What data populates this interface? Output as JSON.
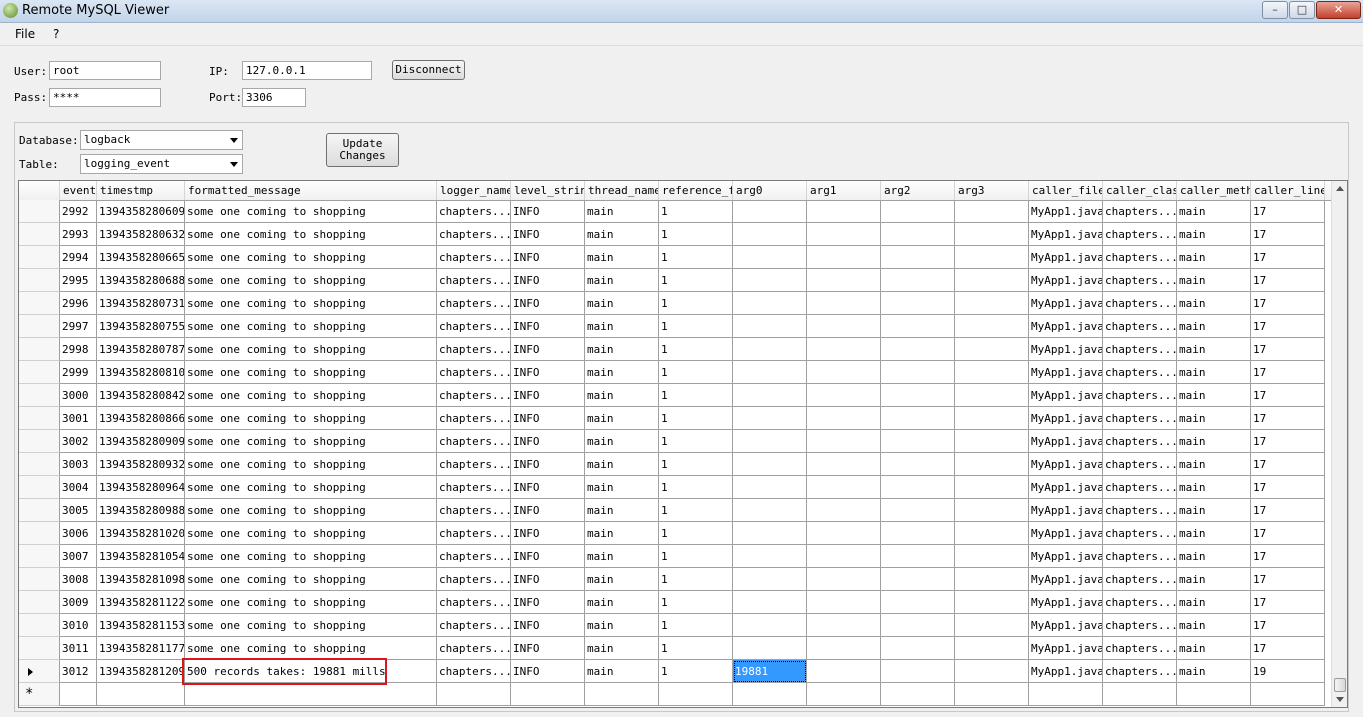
{
  "window": {
    "title": "Remote MySQL Viewer",
    "min": "–",
    "max": "□",
    "close": "✕"
  },
  "menu": [
    {
      "label": "File"
    },
    {
      "label": "?"
    }
  ],
  "connection": {
    "user_label": "User:",
    "user_value": "root",
    "pass_label": "Pass:",
    "pass_value": "****",
    "ip_label": "IP:",
    "ip_value": "127.0.0.1",
    "port_label": "Port:",
    "port_value": "3306",
    "disconnect_label": "Disconnect"
  },
  "selection": {
    "database_label": "Database:",
    "database_value": "logback",
    "table_label": "Table:",
    "table_value": "logging_event",
    "update_line1": "Update",
    "update_line2": "Changes"
  },
  "grid": {
    "columns": [
      "event",
      "timestmp",
      "formatted_message",
      "logger_name",
      "level_strin",
      "thread_name",
      "reference_f",
      "arg0",
      "arg1",
      "arg2",
      "arg3",
      "caller_file",
      "caller_clas",
      "caller_meth",
      "caller_line"
    ],
    "rows": [
      [
        "2992",
        "1394358280609",
        "some one coming to shopping",
        "chapters...",
        "INFO",
        "main",
        "1",
        "",
        "",
        "",
        "",
        "MyApp1.java",
        "chapters...",
        "main",
        "17"
      ],
      [
        "2993",
        "1394358280632",
        "some one coming to shopping",
        "chapters...",
        "INFO",
        "main",
        "1",
        "",
        "",
        "",
        "",
        "MyApp1.java",
        "chapters...",
        "main",
        "17"
      ],
      [
        "2994",
        "1394358280665",
        "some one coming to shopping",
        "chapters...",
        "INFO",
        "main",
        "1",
        "",
        "",
        "",
        "",
        "MyApp1.java",
        "chapters...",
        "main",
        "17"
      ],
      [
        "2995",
        "1394358280688",
        "some one coming to shopping",
        "chapters...",
        "INFO",
        "main",
        "1",
        "",
        "",
        "",
        "",
        "MyApp1.java",
        "chapters...",
        "main",
        "17"
      ],
      [
        "2996",
        "1394358280731",
        "some one coming to shopping",
        "chapters...",
        "INFO",
        "main",
        "1",
        "",
        "",
        "",
        "",
        "MyApp1.java",
        "chapters...",
        "main",
        "17"
      ],
      [
        "2997",
        "1394358280755",
        "some one coming to shopping",
        "chapters...",
        "INFO",
        "main",
        "1",
        "",
        "",
        "",
        "",
        "MyApp1.java",
        "chapters...",
        "main",
        "17"
      ],
      [
        "2998",
        "1394358280787",
        "some one coming to shopping",
        "chapters...",
        "INFO",
        "main",
        "1",
        "",
        "",
        "",
        "",
        "MyApp1.java",
        "chapters...",
        "main",
        "17"
      ],
      [
        "2999",
        "1394358280810",
        "some one coming to shopping",
        "chapters...",
        "INFO",
        "main",
        "1",
        "",
        "",
        "",
        "",
        "MyApp1.java",
        "chapters...",
        "main",
        "17"
      ],
      [
        "3000",
        "1394358280842",
        "some one coming to shopping",
        "chapters...",
        "INFO",
        "main",
        "1",
        "",
        "",
        "",
        "",
        "MyApp1.java",
        "chapters...",
        "main",
        "17"
      ],
      [
        "3001",
        "1394358280866",
        "some one coming to shopping",
        "chapters...",
        "INFO",
        "main",
        "1",
        "",
        "",
        "",
        "",
        "MyApp1.java",
        "chapters...",
        "main",
        "17"
      ],
      [
        "3002",
        "1394358280909",
        "some one coming to shopping",
        "chapters...",
        "INFO",
        "main",
        "1",
        "",
        "",
        "",
        "",
        "MyApp1.java",
        "chapters...",
        "main",
        "17"
      ],
      [
        "3003",
        "1394358280932",
        "some one coming to shopping",
        "chapters...",
        "INFO",
        "main",
        "1",
        "",
        "",
        "",
        "",
        "MyApp1.java",
        "chapters...",
        "main",
        "17"
      ],
      [
        "3004",
        "1394358280964",
        "some one coming to shopping",
        "chapters...",
        "INFO",
        "main",
        "1",
        "",
        "",
        "",
        "",
        "MyApp1.java",
        "chapters...",
        "main",
        "17"
      ],
      [
        "3005",
        "1394358280988",
        "some one coming to shopping",
        "chapters...",
        "INFO",
        "main",
        "1",
        "",
        "",
        "",
        "",
        "MyApp1.java",
        "chapters...",
        "main",
        "17"
      ],
      [
        "3006",
        "1394358281020",
        "some one coming to shopping",
        "chapters...",
        "INFO",
        "main",
        "1",
        "",
        "",
        "",
        "",
        "MyApp1.java",
        "chapters...",
        "main",
        "17"
      ],
      [
        "3007",
        "1394358281054",
        "some one coming to shopping",
        "chapters...",
        "INFO",
        "main",
        "1",
        "",
        "",
        "",
        "",
        "MyApp1.java",
        "chapters...",
        "main",
        "17"
      ],
      [
        "3008",
        "1394358281098",
        "some one coming to shopping",
        "chapters...",
        "INFO",
        "main",
        "1",
        "",
        "",
        "",
        "",
        "MyApp1.java",
        "chapters...",
        "main",
        "17"
      ],
      [
        "3009",
        "1394358281122",
        "some one coming to shopping",
        "chapters...",
        "INFO",
        "main",
        "1",
        "",
        "",
        "",
        "",
        "MyApp1.java",
        "chapters...",
        "main",
        "17"
      ],
      [
        "3010",
        "1394358281153",
        "some one coming to shopping",
        "chapters...",
        "INFO",
        "main",
        "1",
        "",
        "",
        "",
        "",
        "MyApp1.java",
        "chapters...",
        "main",
        "17"
      ],
      [
        "3011",
        "1394358281177",
        "some one coming to shopping",
        "chapters...",
        "INFO",
        "main",
        "1",
        "",
        "",
        "",
        "",
        "MyApp1.java",
        "chapters...",
        "main",
        "17"
      ],
      [
        "3012",
        "1394358281209",
        "500 records takes: 19881 mills",
        "chapters...",
        "INFO",
        "main",
        "1",
        "19881",
        "",
        "",
        "",
        "MyApp1.java",
        "chapters...",
        "main",
        "19"
      ]
    ],
    "new_row_marker": "*"
  },
  "colors": {
    "selection": "#3399ff",
    "highlight": "#d9161a"
  }
}
